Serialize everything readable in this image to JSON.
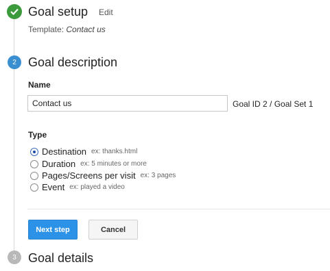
{
  "step1": {
    "icon": "check-icon",
    "title": "Goal setup",
    "edit_label": "Edit",
    "template_prefix": "Template:",
    "template_value": "Contact us"
  },
  "step2": {
    "number": "2",
    "title": "Goal description",
    "name_label": "Name",
    "name_value": "Contact us",
    "goal_id": "Goal ID 2 / Goal Set 1",
    "type_label": "Type",
    "types": [
      {
        "label": "Destination",
        "example": "ex: thanks.html",
        "checked": true
      },
      {
        "label": "Duration",
        "example": "ex: 5 minutes or more",
        "checked": false
      },
      {
        "label": "Pages/Screens per visit",
        "example": "ex: 3 pages",
        "checked": false
      },
      {
        "label": "Event",
        "example": "ex: played a video",
        "checked": false
      }
    ],
    "next_label": "Next step",
    "cancel_label": "Cancel"
  },
  "step3": {
    "number": "3",
    "title": "Goal details"
  },
  "colors": {
    "done": "#3b9a3b",
    "active": "#3a8fd0",
    "pending": "#b8b8b8",
    "primary_button": "#2c92e8"
  }
}
